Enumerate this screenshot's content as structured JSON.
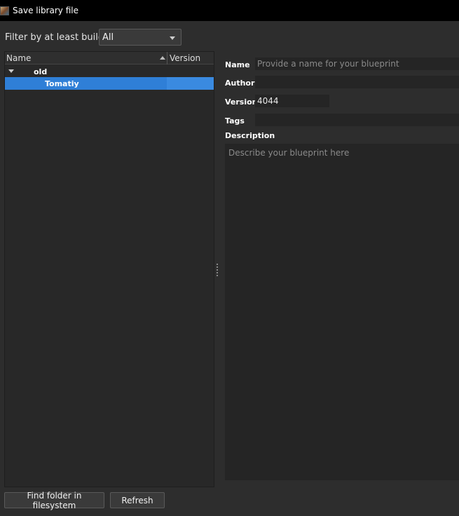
{
  "window": {
    "title": "Save library file"
  },
  "filter": {
    "label": "Filter by at least build:",
    "selected": "All"
  },
  "tree": {
    "columns": {
      "name": "Name",
      "version": "Version"
    },
    "folder": {
      "label": "old"
    },
    "items": [
      {
        "label": "Tomatiy",
        "version": ""
      }
    ]
  },
  "form": {
    "name": {
      "label": "Name",
      "value": "",
      "placeholder": "Provide a name for your blueprint"
    },
    "author": {
      "label": "Author",
      "value": ""
    },
    "version": {
      "label": "Version",
      "value": "4044"
    },
    "tags": {
      "label": "Tags",
      "value": ""
    },
    "description": {
      "label": "Description",
      "value": "",
      "placeholder": "Describe your blueprint here"
    }
  },
  "buttons": {
    "find_folder": "Find folder in filesystem",
    "refresh": "Refresh"
  },
  "colors": {
    "selection": "#2f7fd7",
    "background": "#2d2d2d",
    "titlebar": "#000000"
  }
}
